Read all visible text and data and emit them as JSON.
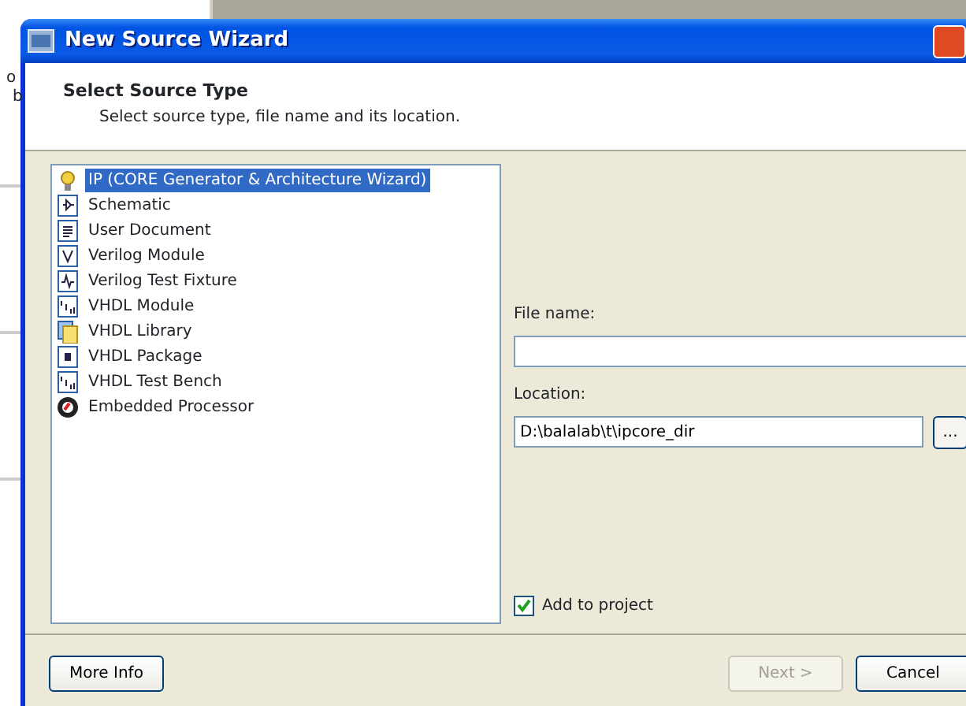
{
  "background": {
    "fragments": [
      "o",
      "b"
    ]
  },
  "window": {
    "title": "New Source Wizard"
  },
  "header": {
    "title": "Select Source Type",
    "subtitle": "Select source type, file name and its location."
  },
  "source_types": [
    {
      "label": "IP (CORE Generator & Architecture Wizard)",
      "kind": "ip",
      "selected": true
    },
    {
      "label": "Schematic",
      "kind": "schematic",
      "selected": false
    },
    {
      "label": "User Document",
      "kind": "document",
      "selected": false
    },
    {
      "label": "Verilog Module",
      "kind": "verilog",
      "selected": false
    },
    {
      "label": "Verilog Test Fixture",
      "kind": "waveform",
      "selected": false
    },
    {
      "label": "VHDL Module",
      "kind": "vhdl",
      "selected": false
    },
    {
      "label": "VHDL Library",
      "kind": "library",
      "selected": false
    },
    {
      "label": "VHDL Package",
      "kind": "package",
      "selected": false
    },
    {
      "label": "VHDL Test Bench",
      "kind": "vhdl",
      "selected": false
    },
    {
      "label": "Embedded Processor",
      "kind": "processor",
      "selected": false
    }
  ],
  "file_name": {
    "label": "File name:"
  },
  "location": {
    "label": "Location:",
    "value": "D:\\balalab\\t\\ipcore_dir",
    "browse": "..."
  },
  "add_to_project": {
    "label": "Add to project",
    "checked": true
  },
  "buttons": [
    {
      "label": "More Info",
      "disabled": false
    },
    {
      "label": "Next >",
      "disabled": true
    },
    {
      "label": "Cancel",
      "disabled": false
    }
  ]
}
